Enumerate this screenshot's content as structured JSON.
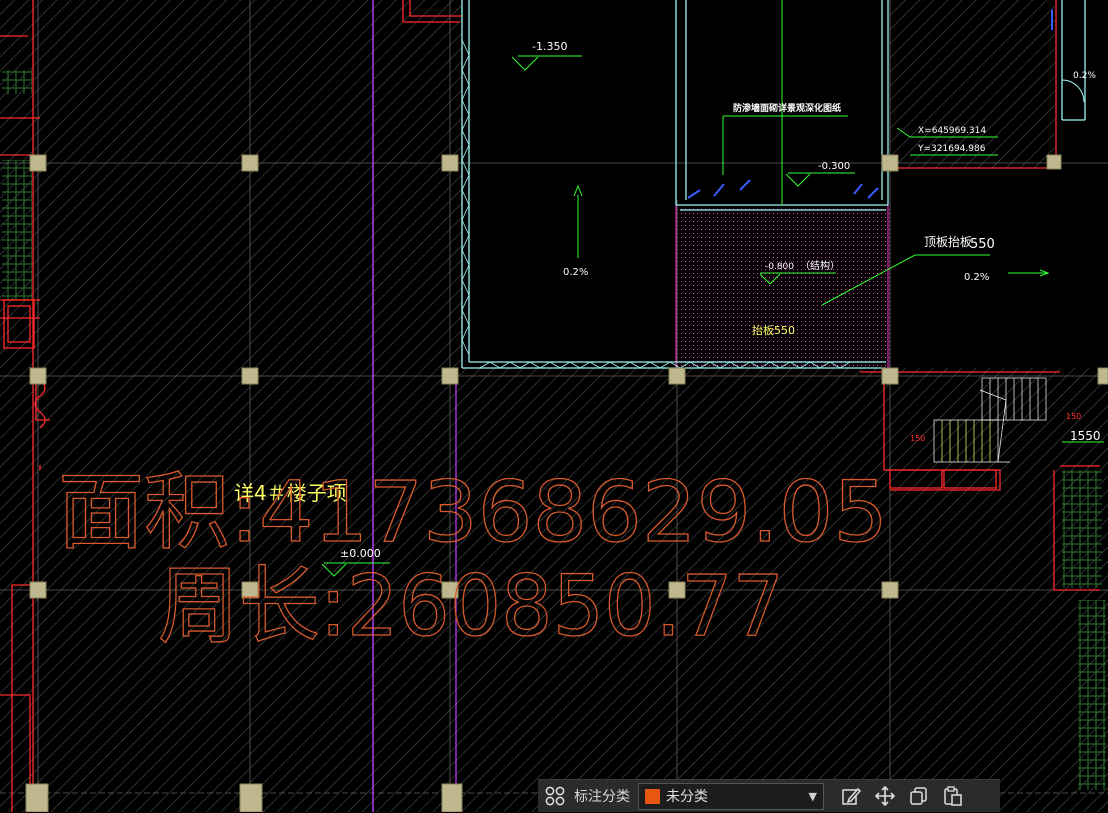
{
  "drawing": {
    "labels": {
      "elev_top": "-1.350",
      "elev_minus300": "-0.300",
      "elev_minus800": "-0.800",
      "struct_note": "（结构）",
      "elev_zero": "±0.000",
      "slope_a": "0.2%",
      "slope_b": "0.2%",
      "slope_c": "0.2%",
      "coord_x": "X=645969.314",
      "coord_y": "Y=321694.986",
      "roof_slab": "顶板抬板",
      "roof_slab_value": "550",
      "lift_slab": "抬板550",
      "header_note": "防渗墙面砌详景观深化图纸",
      "dim_1550": "1550",
      "dim_150a": "150",
      "dim_150b": "150",
      "detail_label": "详4＃楼子项"
    },
    "measurements": {
      "area": "面积:417368629.05",
      "perimeter": "周长:260850.77"
    },
    "colors": {
      "background": "#000000",
      "hatch": "#5a5a5a",
      "grid_line": "#606060",
      "wall_red": "#ff2a2a",
      "wall_cyan": "#9cf5f5",
      "yellow_text": "#ffff66",
      "green": "#33ff33",
      "purple": "#c040ff",
      "magenta": "#ff33cc",
      "column": "#bfb88f",
      "measure_orange": "#d85a2c"
    }
  },
  "toolbar": {
    "category_label": "标注分类",
    "category_value": "未分类",
    "swatch_color": "#e8570f",
    "icons": [
      "grid-menu-icon",
      "edit-icon",
      "move-icon",
      "copy-icon",
      "paste-icon"
    ]
  }
}
